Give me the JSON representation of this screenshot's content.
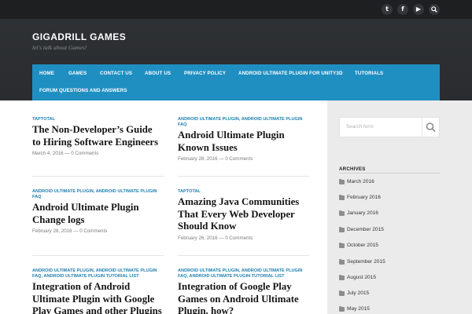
{
  "site": {
    "title": "GIGADRILL GAMES",
    "tagline": "let's talk about Games!"
  },
  "social_icons": [
    "twitter-icon",
    "facebook-icon",
    "youtube-icon",
    "search-icon"
  ],
  "nav": {
    "items": [
      "HOME",
      "GAMES",
      "CONTACT US",
      "ABOUT US",
      "PRIVACY POLICY",
      "ANDROID ULTIMATE PLUGIN FOR UNITY3D",
      "TUTORIALS",
      "FORUM QUESTIONS AND ANSWERS"
    ]
  },
  "posts": [
    {
      "categories": "TAPTOTAL",
      "title": "The Non-Developer’s Guide to Hiring Software Engineers",
      "date": "March 4, 2016",
      "comments": "0 Comments"
    },
    {
      "categories": "ANDROID ULTIMATE PLUGIN, ANDROID ULTIMATE PLUGIN FAQ",
      "title": "Android Ultimate Plugin Known Issues",
      "date": "February 28, 2016",
      "comments": "0 Comments"
    },
    {
      "categories": "ANDROID ULTIMATE PLUGIN, ANDROID ULTIMATE PLUGIN FAQ",
      "title": "Android Ultimate Plugin Change logs",
      "date": "February 28, 2016",
      "comments": "0 Comments"
    },
    {
      "categories": "TAPTOTAL",
      "title": "Amazing Java Communities That Every Web Developer Should Know",
      "date": "February 26, 2016",
      "comments": "0 Comments"
    },
    {
      "categories": "ANDROID ULTIMATE PLUGIN, ANDROID ULTIMATE PLUGIN FAQ, ANDROID ULTIMATE PLUGIN TUTORIAL LIST",
      "title": "Integration of Android Ultimate Plugin with Google Play Games and other Plugins",
      "date": "",
      "comments": ""
    },
    {
      "categories": "ANDROID ULTIMATE PLUGIN, ANDROID ULTIMATE PLUGIN FAQ, ANDROID ULTIMATE PLUGIN TUTORIAL LIST",
      "title": "Integration of Google Play Games on Android Ultimate Plugin, how?",
      "date": "",
      "comments": ""
    }
  ],
  "meta_separator": "—",
  "sidebar": {
    "search_placeholder": "Search form",
    "archives_title": "ARCHIVES",
    "archives": [
      "March 2016",
      "February 2016",
      "January 2016",
      "December 2015",
      "October 2015",
      "September 2015",
      "August 2015",
      "July 2015",
      "May 2015"
    ]
  },
  "colors": {
    "topbar": "#1d1f21",
    "header": "#2e3134",
    "nav": "#1f8fc2",
    "category_link": "#1f7fb0",
    "sidebar": "#ebebeb"
  }
}
